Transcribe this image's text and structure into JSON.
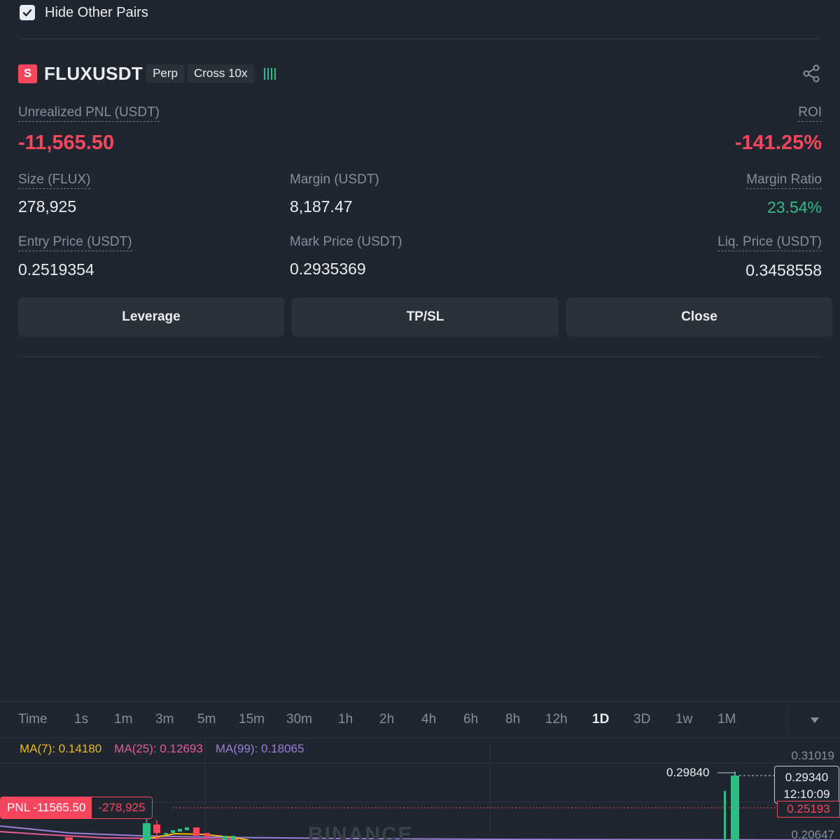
{
  "filter": {
    "hide_other_pairs_label": "Hide Other Pairs",
    "hide_other_pairs_checked": true
  },
  "position": {
    "side_badge": "S",
    "symbol": "FLUXUSDT",
    "contract_tag": "Perp",
    "margin_tag": "Cross 10x",
    "unrealized_pnl_label": "Unrealized PNL (USDT)",
    "unrealized_pnl_value": "-11,565.50",
    "roi_label": "ROI",
    "roi_value": "-141.25%",
    "size_label": "Size (FLUX)",
    "size_value": "278,925",
    "margin_label": "Margin (USDT)",
    "margin_value": "8,187.47",
    "margin_ratio_label": "Margin Ratio",
    "margin_ratio_value": "23.54%",
    "entry_price_label": "Entry Price (USDT)",
    "entry_price_value": "0.2519354",
    "mark_price_label": "Mark Price (USDT)",
    "mark_price_value": "0.2935369",
    "liq_price_label": "Liq. Price (USDT)",
    "liq_price_value": "0.3458558"
  },
  "actions": {
    "leverage": "Leverage",
    "tpsl": "TP/SL",
    "close": "Close"
  },
  "chart": {
    "timeframes": [
      "Time",
      "1s",
      "1m",
      "3m",
      "5m",
      "15m",
      "30m",
      "1h",
      "2h",
      "4h",
      "6h",
      "8h",
      "12h",
      "1D",
      "3D",
      "1w",
      "1M"
    ],
    "active_timeframe": "1D",
    "ma7": "MA(7): 0.14180",
    "ma25": "MA(25): 0.12693",
    "ma99": "MA(99): 0.18065",
    "price_high_axis": "0.31019",
    "price_low_axis": "0.20647",
    "high_marker": "0.29840",
    "current_price": "0.29340",
    "countdown": "12:10:09",
    "entry_line_price": "0.25193",
    "pnl_tag_label": "PNL -11565.50",
    "pnl_tag_size": "-278,925",
    "watermark": "BINANCE",
    "colors": {
      "up": "#2ebd85",
      "down": "#f6465d",
      "ma7": "#f0b90b",
      "ma25": "#e65a9c",
      "ma99": "#9b7ed6"
    }
  }
}
